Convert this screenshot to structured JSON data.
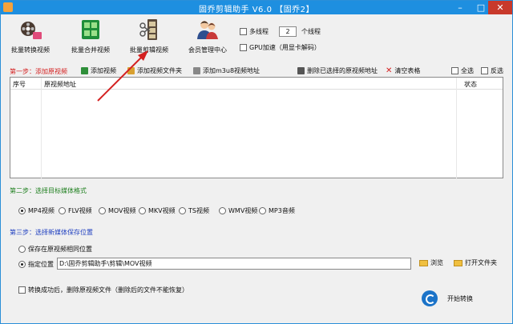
{
  "window": {
    "title": "固乔剪辑助手 V6.0 【固乔2】"
  },
  "toolbar": {
    "items": [
      {
        "label": "批量转换视频",
        "icon": "film-reel-icon"
      },
      {
        "label": "批量合并视频",
        "icon": "film-grid-icon"
      },
      {
        "label": "批量剪辑视频",
        "icon": "film-scissors-icon"
      },
      {
        "label": "会员管理中心",
        "icon": "members-icon"
      }
    ],
    "multithread_label": "多线程",
    "thread_count": "2",
    "thread_unit": "个线程",
    "gpu_label": "GPU加速（用显卡解码）"
  },
  "step1": {
    "title": "第一步：添加原视频",
    "add_video": "添加视频",
    "add_folder": "添加视频文件夹",
    "add_m3u8": "添加m3u8视频地址",
    "delete_selected": "删除已选择的原视频地址",
    "clear_table": "清空表格",
    "select_all": "全选",
    "invert_select": "反选",
    "columns": [
      "序号",
      "原视频地址",
      "状态"
    ]
  },
  "step2": {
    "title": "第二步：选择目标媒体格式",
    "formats": [
      "MP4视频",
      "FLV视频",
      "MOV视频",
      "MKV视频",
      "TS视频",
      "WMV视频",
      "MP3音频"
    ],
    "selected": "MP4视频"
  },
  "step3": {
    "title": "第三步：选择新媒体保存位置",
    "same_location": "保存在原视频相同位置",
    "custom_location": "指定位置",
    "path": "D:\\固乔剪辑助手\\剪辑\\MOV视频",
    "browse": "浏览",
    "open_folder": "打开文件夹"
  },
  "footer": {
    "delete_after": "转换成功后，删除原视频文件（删除后的文件不能恢复）",
    "start": "开始转换"
  },
  "colors": {
    "titlebar": "#1e8fe0",
    "close": "#c8392b",
    "step1": "#d42020",
    "step2": "#208020",
    "step3": "#2040c0",
    "arrow": "#d42020"
  }
}
